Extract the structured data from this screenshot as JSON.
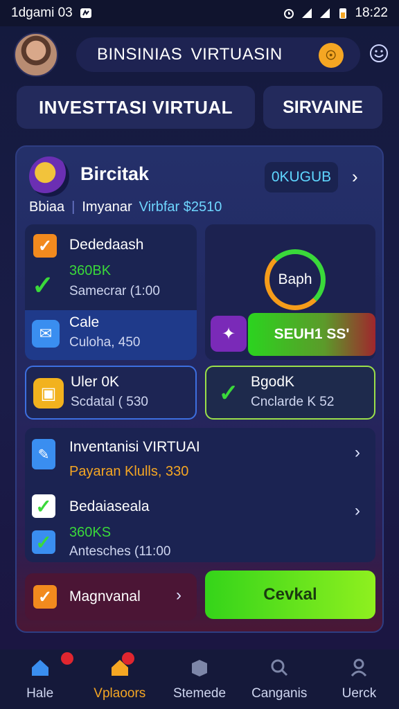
{
  "status_bar": {
    "left_text": "1dgami 03",
    "time": "18:22"
  },
  "header": {
    "title": "BINSINIAS  VIRTUASIN",
    "coin_glyph": "☉"
  },
  "tabs": {
    "main": "INVESTTASI VIRTUAL",
    "second": "SIRVAINE"
  },
  "panel": {
    "title": "Bircitak",
    "badge": "0KUGUB",
    "sub_a": "Bbiaa",
    "sub_b": "Imyanar",
    "sub_c": "Virbfar $2510"
  },
  "card_left": {
    "title": "Dededaash",
    "amount": "360BK",
    "subtitle": "Samecrar (1:00",
    "blue_title": "Cale",
    "blue_sub": "Culoha, 450"
  },
  "card_right": {
    "ring_label": "Baph",
    "button": "SEUH1 SS'"
  },
  "mid_left": {
    "title": "Uler 0K",
    "sub": "Scdatal ( 530"
  },
  "mid_right": {
    "title": "BgodK",
    "sub": "Cnclarde K 52"
  },
  "list": {
    "item1_title": "Inventanisi VIRTUAI",
    "item1_sub": "Payaran Klulls, 330",
    "item2_title": "Bedaiaseala",
    "item2_amount": "360KS",
    "item2_sub": "Antesches (11:00"
  },
  "bottom": {
    "left_label": "Magnvanal",
    "right_button": "Cevkal"
  },
  "nav": [
    {
      "label": "Hale"
    },
    {
      "label": "Vplaoors"
    },
    {
      "label": "Stemede"
    },
    {
      "label": "Canganis"
    },
    {
      "label": "Uerck"
    }
  ],
  "colors": {
    "accent_orange": "#f5a623",
    "accent_green": "#3ad93a",
    "accent_cyan": "#6fd6ff"
  }
}
